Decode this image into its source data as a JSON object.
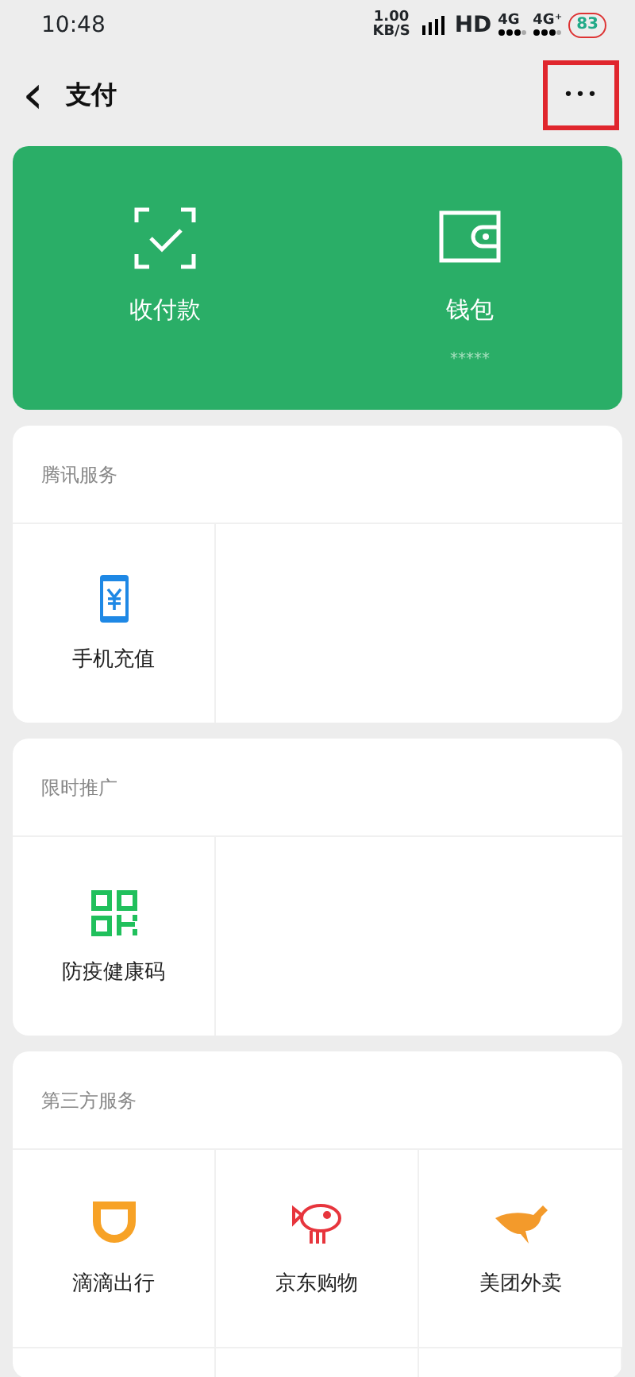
{
  "status_bar": {
    "time": "10:48",
    "speed": "1.00",
    "speed_unit": "KB/S",
    "hd": "HD",
    "net1": "4G",
    "net2": "4G⁺",
    "battery": "83"
  },
  "header": {
    "back": "‹",
    "title": "支付",
    "more": "•••",
    "highlighted": true
  },
  "wallet_card": {
    "items": [
      {
        "label": "收付款"
      },
      {
        "label": "钱包",
        "sub": "*****"
      }
    ]
  },
  "sections": [
    {
      "title": "腾讯服务",
      "items": [
        {
          "label": "手机充值"
        }
      ]
    },
    {
      "title": "限时推广",
      "items": [
        {
          "label": "防疫健康码"
        }
      ]
    },
    {
      "title": "第三方服务",
      "items": [
        {
          "label": "滴滴出行"
        },
        {
          "label": "京东购物"
        },
        {
          "label": "美团外卖"
        }
      ]
    }
  ]
}
